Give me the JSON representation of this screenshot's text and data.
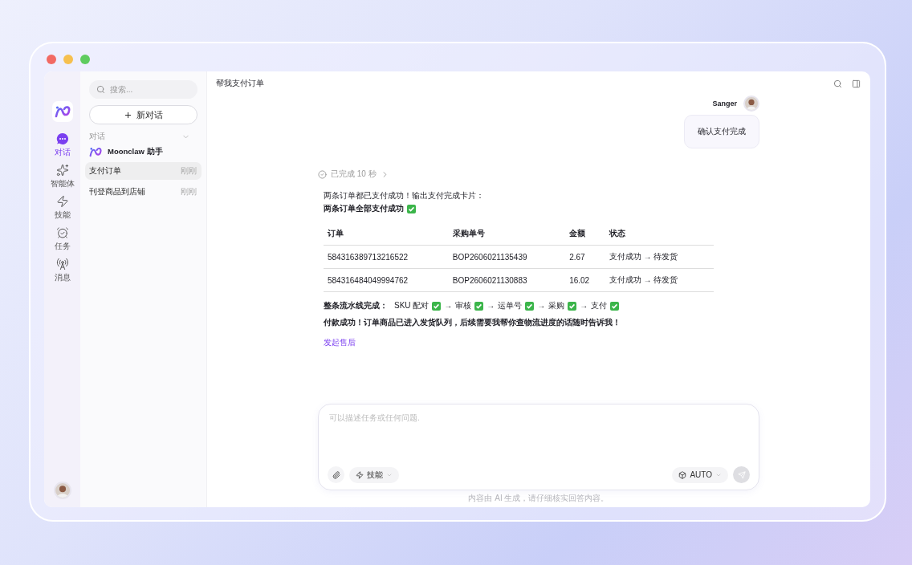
{
  "rail": {
    "items": [
      {
        "label": "对话",
        "selected": true
      },
      {
        "label": "智能体",
        "selected": false
      },
      {
        "label": "技能",
        "selected": false
      },
      {
        "label": "任务",
        "selected": false
      },
      {
        "label": "消息",
        "selected": false
      }
    ]
  },
  "sidebar": {
    "search": {
      "placeholder": "搜索..."
    },
    "new_button": "新对话",
    "section": {
      "title": "对话",
      "expanded": true
    },
    "assistant": "Moonclaw 助手",
    "items": [
      {
        "title": "支付订单",
        "time": "刚刚",
        "selected": true
      },
      {
        "title": "刊登商品到店铺",
        "time": "刚刚",
        "selected": false
      }
    ]
  },
  "header": {
    "title": "帮我支付订单"
  },
  "user_message": {
    "name": "Sanger",
    "text": "确认支付完成"
  },
  "reply": {
    "status": "已完成 10 秒",
    "intro": "两条订单都已支付成功！输出支付完成卡片：",
    "headline": {
      "text": "两条订单全部支付成功",
      "done": true
    },
    "table": {
      "columns": [
        "订单",
        "采购单号",
        "金额",
        "状态"
      ],
      "rows": [
        [
          "584316389713216522",
          "BOP2606021135439",
          "2.67",
          "支付成功 → 待发货"
        ],
        [
          "584316484049994762",
          "BOP2606021130883",
          "16.02",
          "支付成功 → 待发货"
        ]
      ]
    },
    "pipeline": {
      "label": "整条流水线完成：",
      "separator": "→",
      "steps": [
        {
          "text": "SKU 配对",
          "done": true
        },
        {
          "text": "审核",
          "done": true
        },
        {
          "text": "运单号",
          "done": true
        },
        {
          "text": "采购",
          "done": true
        },
        {
          "text": "支付",
          "done": true
        }
      ]
    },
    "closing": "付款成功！订单商品已进入发货队列，后续需要我帮你查物流进度的话随时告诉我！",
    "link": "发起售后"
  },
  "composer": {
    "placeholder": "可以描述任务或任何问题.",
    "skill_button": "技能",
    "model_button": "AUTO",
    "send_disabled": true
  },
  "footer": "内容由 AI 生成，请仔细核实回答内容。"
}
